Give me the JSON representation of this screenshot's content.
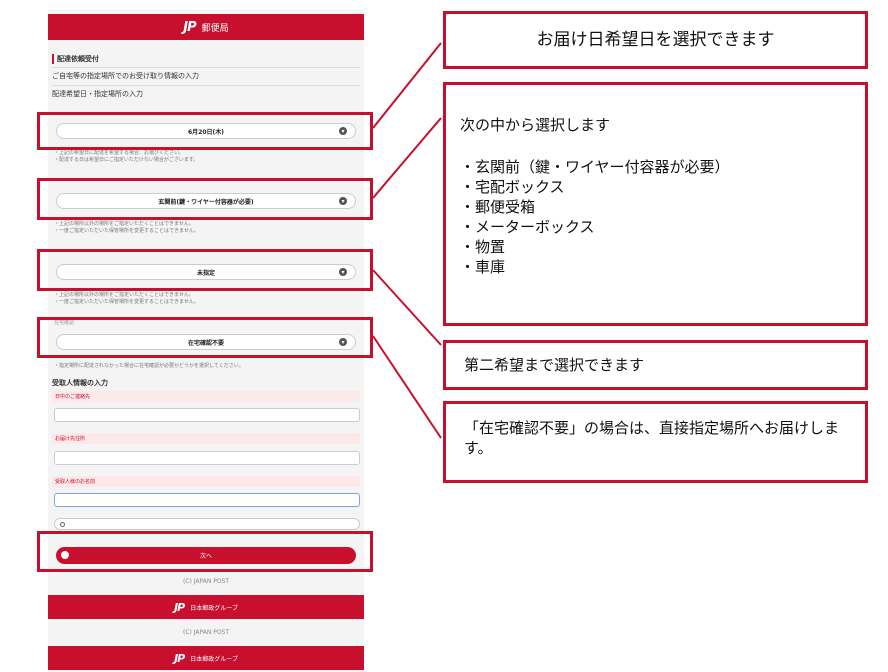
{
  "header": {
    "logo_mark": "JP",
    "logo_text": "郵便局"
  },
  "sections": {
    "top": "配達依頼受付",
    "row1": "ご自宅等の指定場所でのお受け取り情報の入力",
    "row2": "配達希望日・指定場所の入力"
  },
  "selects": {
    "date": "6月20日(木)",
    "place1": "玄関前(鍵・ワイヤー付容器が必要)",
    "place2": "未指定",
    "confirm": "在宅確認不要"
  },
  "notes": {
    "n1a": "・上記の希望日に配達を希望する場合、お選びください。",
    "n1b": "・配達する日は希望日にご指定いただけない場合がございます。",
    "n2a": "・上記の場所以外の場所をご指定いただくことはできません。",
    "n2b": "・一度ご指定いただいた保管場所を変更することはできません。",
    "n3a": "・上記の場所以外の場所をご指定いただくことはできません。",
    "n3b": "・一度ご指定いただいた保管場所を変更することはできません。",
    "n4": "・指定場所に配達されなかった場合に在宅確認が必要かどうかを選択してください。"
  },
  "labels": {
    "confirm_label": "在宅確認",
    "recipient_section": "受取人情報の入力",
    "field1": "日中のご連絡先",
    "field2": "お届け先住所",
    "field3": "受取人様のお名前"
  },
  "next_button": "次へ",
  "footer": {
    "copyright": "(C) JAPAN POST",
    "group": "日本郵政グループ"
  },
  "callouts": {
    "c1": "お届け日希望日を選択できます",
    "c2_intro": "次の中から選択します",
    "c2_items": [
      "・玄関前（鍵・ワイヤー付容器が必要）",
      "・宅配ボックス",
      "・郵便受箱",
      "・メーターボックス",
      "・物置",
      "・車庫"
    ],
    "c3": "第二希望まで選択できます",
    "c4": "「在宅確認不要」の場合は、直接指定場所へお届けします。"
  },
  "colors": {
    "brand_red": "#c8102e"
  }
}
